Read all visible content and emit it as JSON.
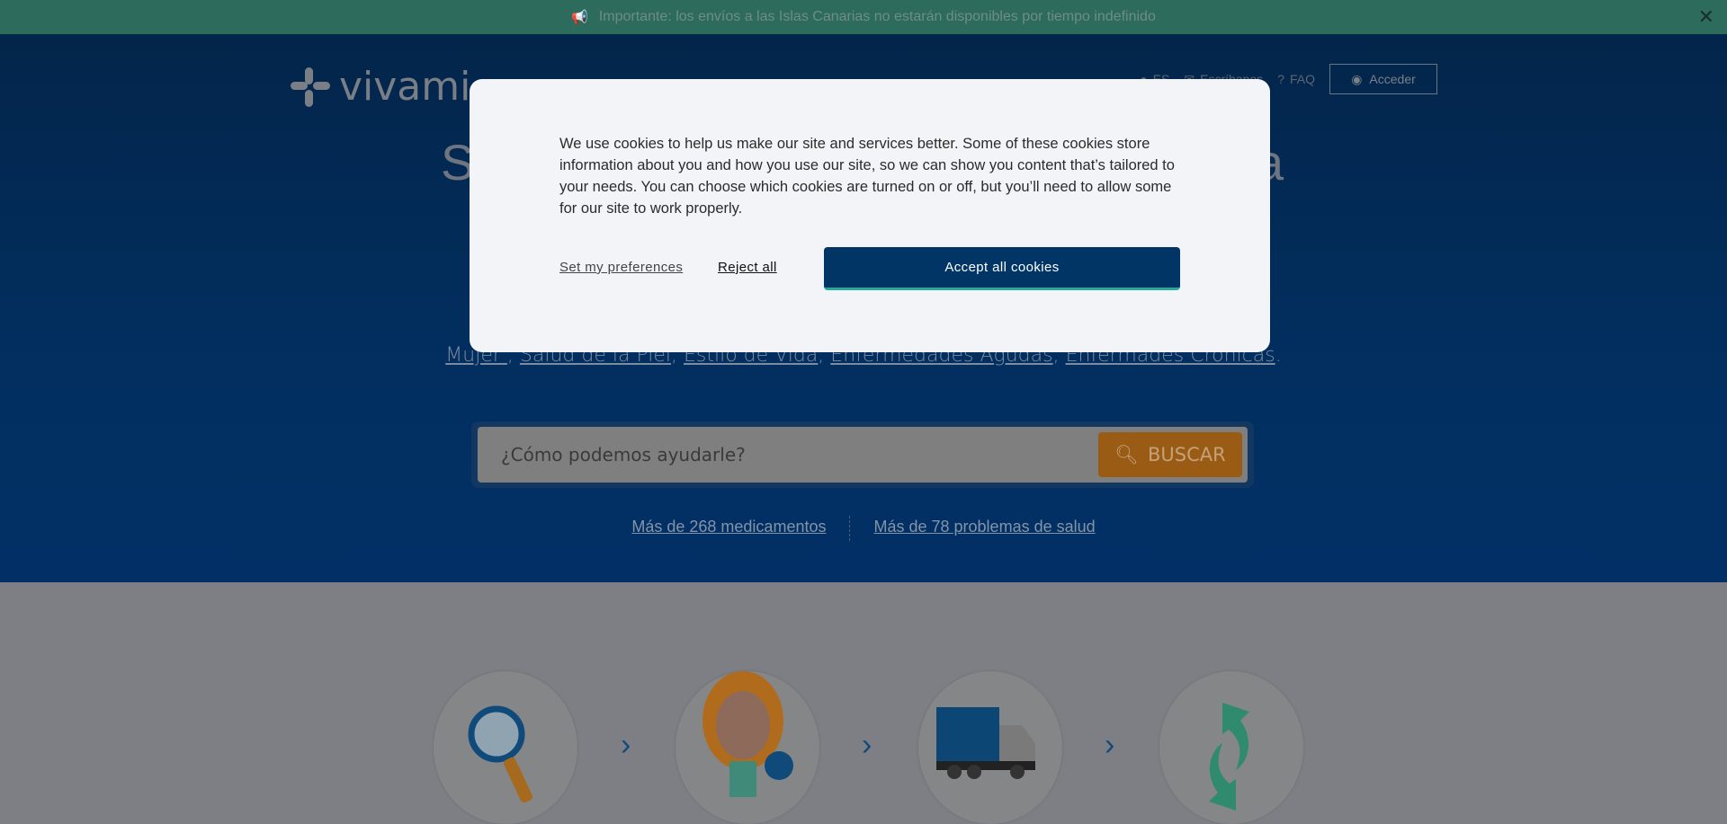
{
  "banner": {
    "text": "Importante: los envíos a las Islas Canarias no estarán disponibles por tiempo indefinido",
    "icon": "megaphone-icon",
    "close": "✕"
  },
  "header": {
    "logo": "vivami",
    "nav": {
      "language": "ES",
      "contact": "Escríbanos",
      "faq": "FAQ",
      "login": "Acceder"
    }
  },
  "hero": {
    "title_visible_start": "S",
    "title_visible_end": "a",
    "categories": [
      "Mujer ",
      "Salud de la Piel",
      "Estilo de Vida",
      "Enfermedades Agudas",
      "Enfermades Crónicas"
    ],
    "search": {
      "placeholder": "¿Cómo podemos ayudarle?",
      "button": "BUSCAR"
    },
    "stats": [
      "Más de 268 medicamentos",
      "Más de 78 problemas de salud"
    ]
  },
  "steps": [
    "magnifier-icon",
    "doctor-icon",
    "delivery-truck-icon",
    "refresh-icon"
  ],
  "cookie_modal": {
    "text": "We use cookies to help us make our site and services better. Some of these cookies store information about you and how you use our site, so we can show you content that’s tailored to your needs. You can choose which cookies are turned on or off, but you’ll need to allow some for our site to work properly.",
    "preferences": "Set my preferences",
    "reject": "Reject all",
    "accept": "Accept all cookies"
  },
  "colors": {
    "accent": "#013566",
    "search_button": "#e08a1e",
    "banner": "#55d4b4"
  }
}
